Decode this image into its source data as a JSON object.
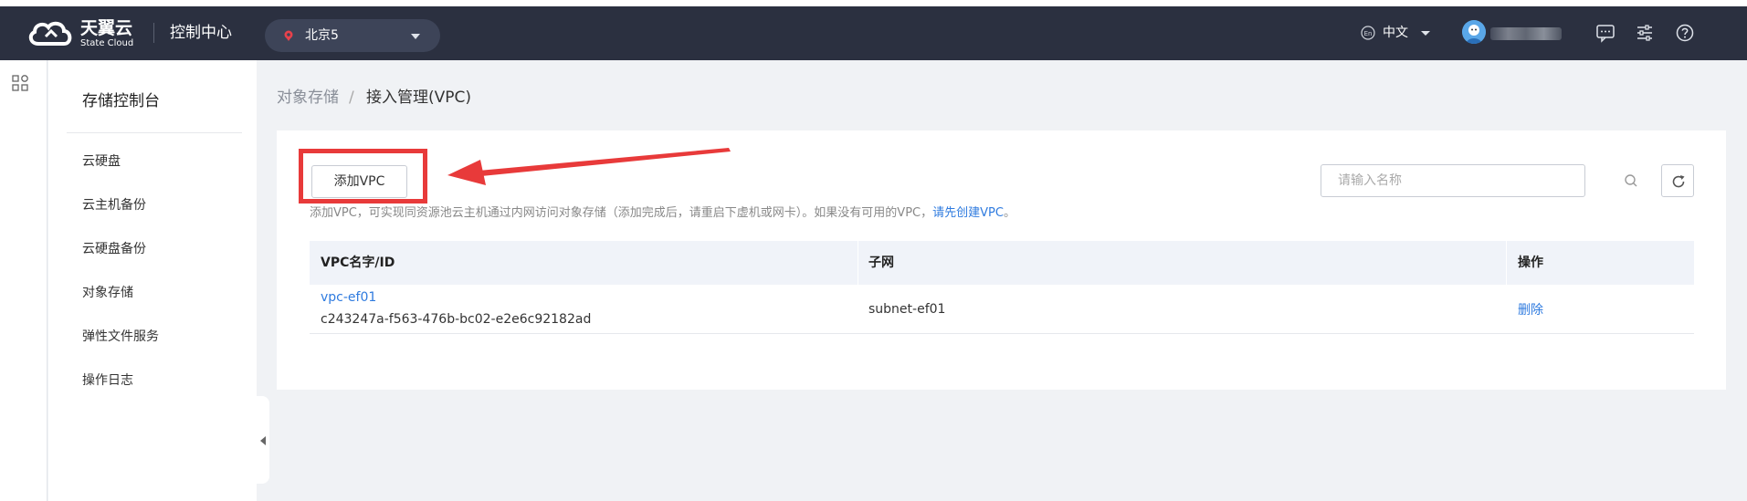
{
  "topbar": {
    "logo_text": "天翼云",
    "logo_sub": "State Cloud",
    "console_title": "控制中心",
    "region": "北京5",
    "language": "中文",
    "language_icon_text": "En",
    "icons": [
      "message-icon",
      "sliders-icon",
      "help-icon"
    ]
  },
  "sidebar": {
    "title": "存储控制台",
    "items": [
      {
        "label": "云硬盘"
      },
      {
        "label": "云主机备份"
      },
      {
        "label": "云硬盘备份"
      },
      {
        "label": "对象存储"
      },
      {
        "label": "弹性文件服务"
      },
      {
        "label": "操作日志"
      }
    ]
  },
  "breadcrumb": {
    "parent": "对象存储",
    "separator": "/",
    "current": "接入管理(VPC)"
  },
  "toolbar": {
    "add_label": "添加VPC",
    "hint_text": "添加VPC，可实现同资源池云主机通过内网访问对象存储（添加完成后，请重启下虚机或网卡）。如果没有可用的VPC，",
    "hint_link": "请先创建VPC",
    "hint_end": "。",
    "search_placeholder": "请输入名称"
  },
  "table": {
    "columns": [
      "VPC名字/ID",
      "子网",
      "操作"
    ],
    "rows": [
      {
        "vpc_name": "vpc-ef01",
        "vpc_id": "c243247a-f563-476b-bc02-e2e6c92182ad",
        "subnet": "subnet-ef01",
        "action": "删除"
      }
    ]
  },
  "colors": {
    "topbar": "#2b3040",
    "accent": "#2f7bdf",
    "annotation": "#e83a3a"
  }
}
